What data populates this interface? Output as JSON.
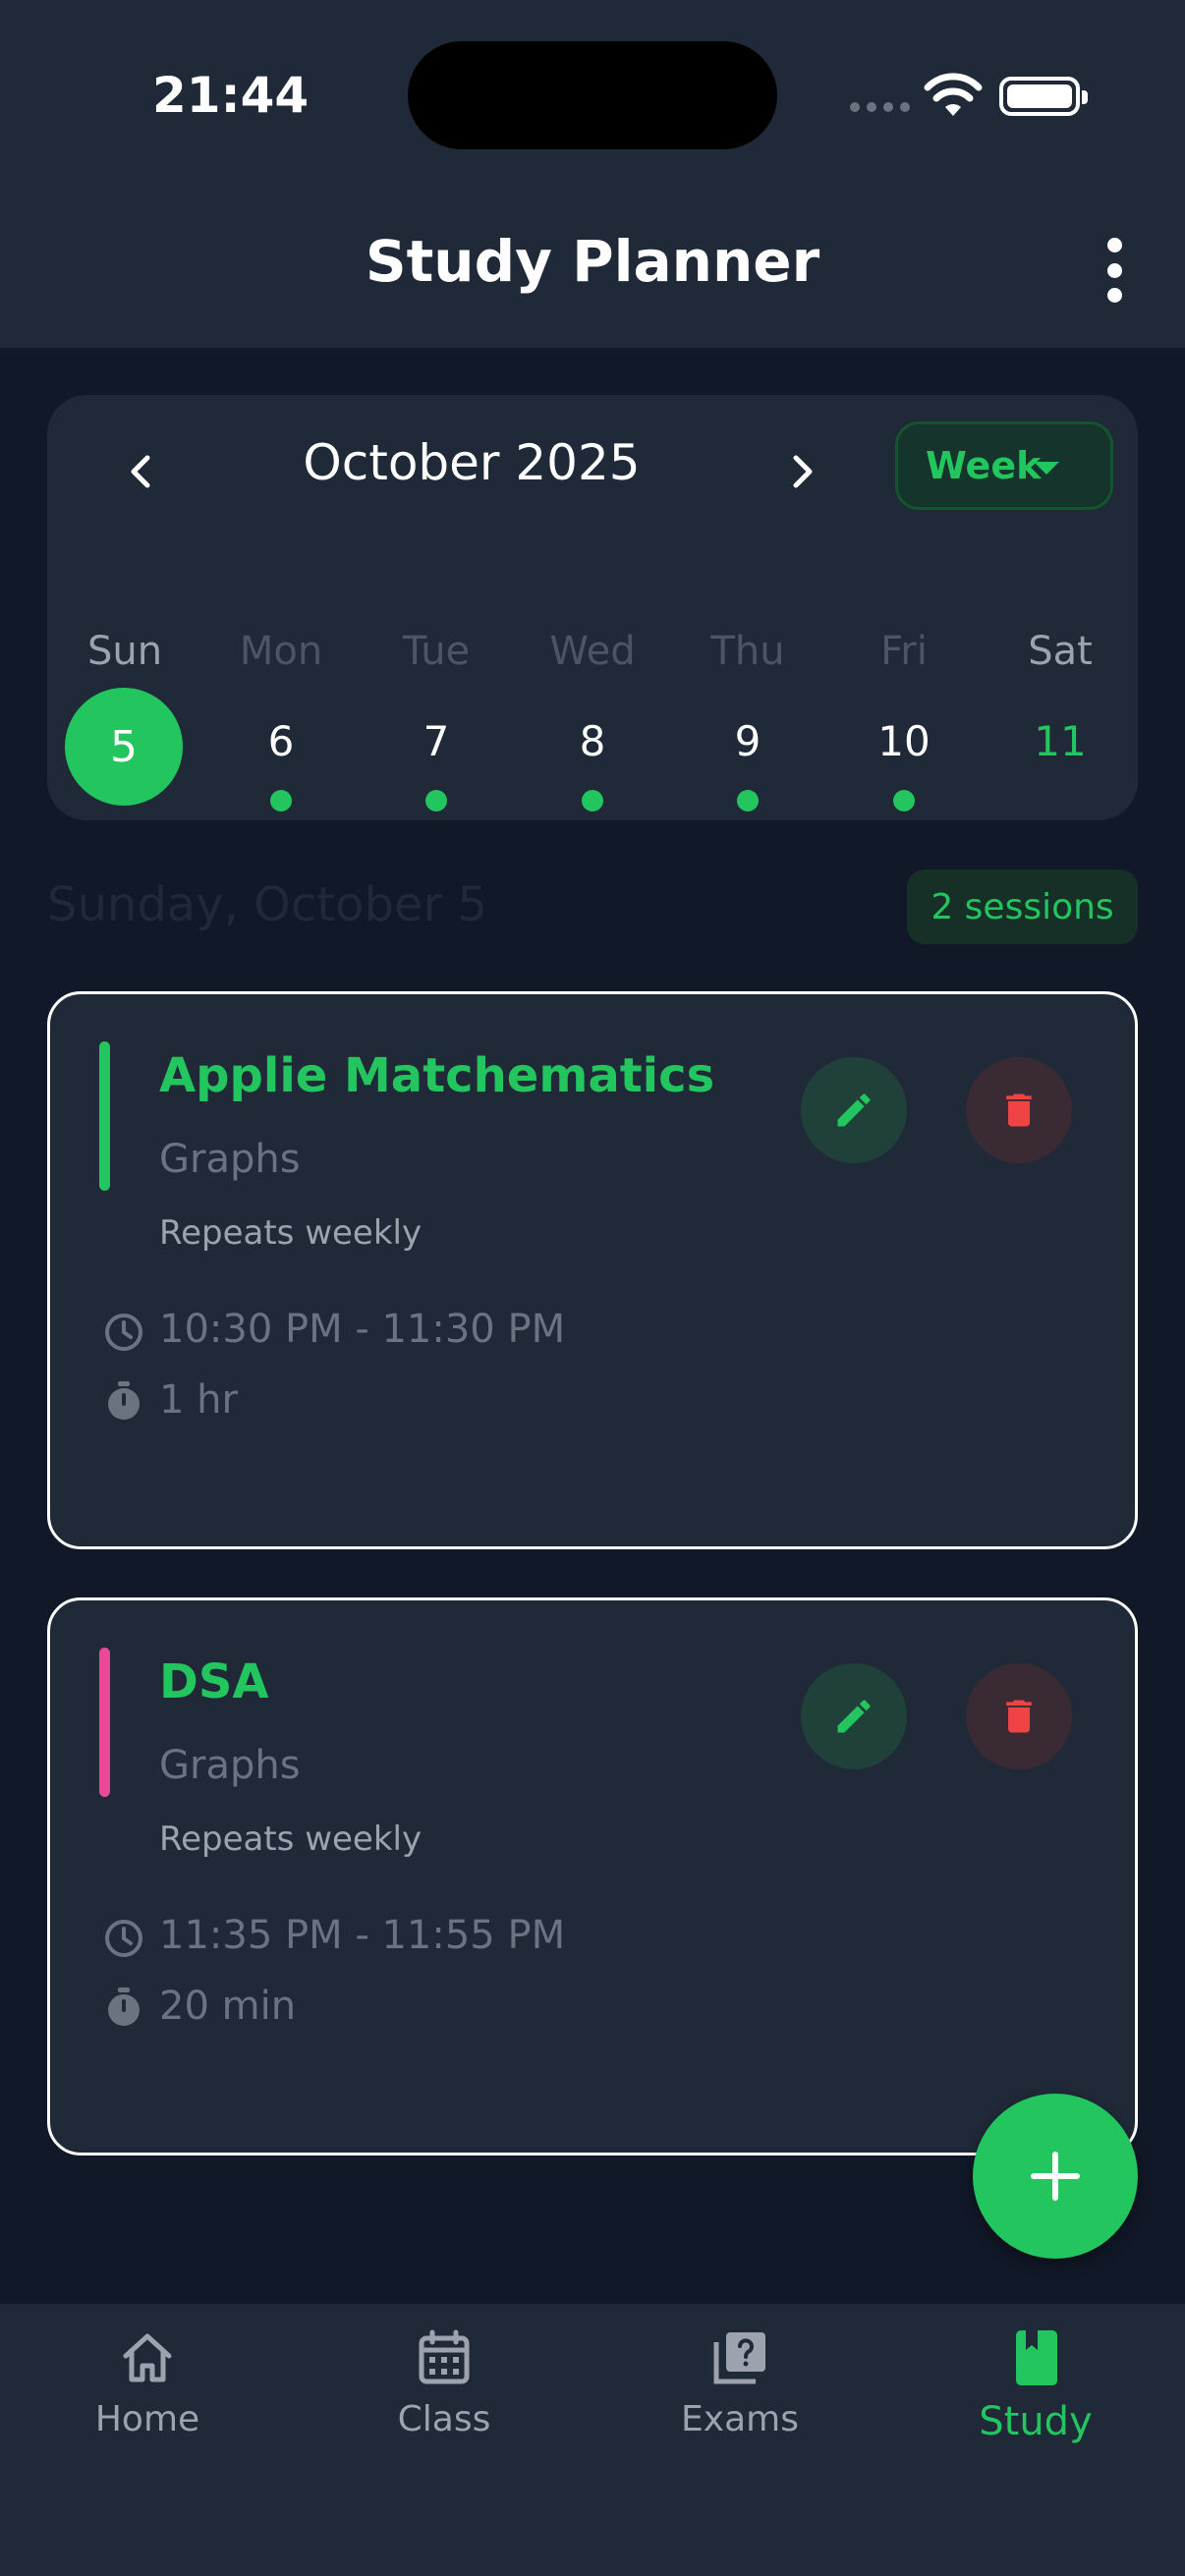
{
  "status_bar": {
    "time": "21:44"
  },
  "header": {
    "title": "Study Planner"
  },
  "calendar": {
    "month_label": "October 2025",
    "view_mode": "Week",
    "weekdays": [
      "Sun",
      "Mon",
      "Tue",
      "Wed",
      "Thu",
      "Fri",
      "Sat"
    ],
    "days": [
      "5",
      "6",
      "7",
      "8",
      "9",
      "10",
      "11"
    ],
    "selected_day": "5"
  },
  "day_summary": {
    "date_label": "Sunday, October 5",
    "sessions_label": "2 sessions"
  },
  "sessions": [
    {
      "title": "Applie Matchematics",
      "topic": "Graphs",
      "repeat": "Repeats weekly",
      "time": "10:30 PM - 11:30 PM",
      "duration": "1 hr",
      "accent_color": "#22c55e"
    },
    {
      "title": "DSA",
      "topic": "Graphs",
      "repeat": "Repeats weekly",
      "time": "11:35 PM - 11:55 PM",
      "duration": "20 min",
      "accent_color": "#ec4899"
    }
  ],
  "bottom_nav": {
    "items": [
      {
        "label": "Home",
        "icon": "home-icon"
      },
      {
        "label": "Class",
        "icon": "calendar-icon"
      },
      {
        "label": "Exams",
        "icon": "quiz-icon"
      },
      {
        "label": "Study",
        "icon": "book-icon",
        "active": true
      }
    ]
  },
  "colors": {
    "accent": "#22c55e",
    "danger": "#ef4444",
    "background": "#111827",
    "surface": "#1f2937"
  }
}
